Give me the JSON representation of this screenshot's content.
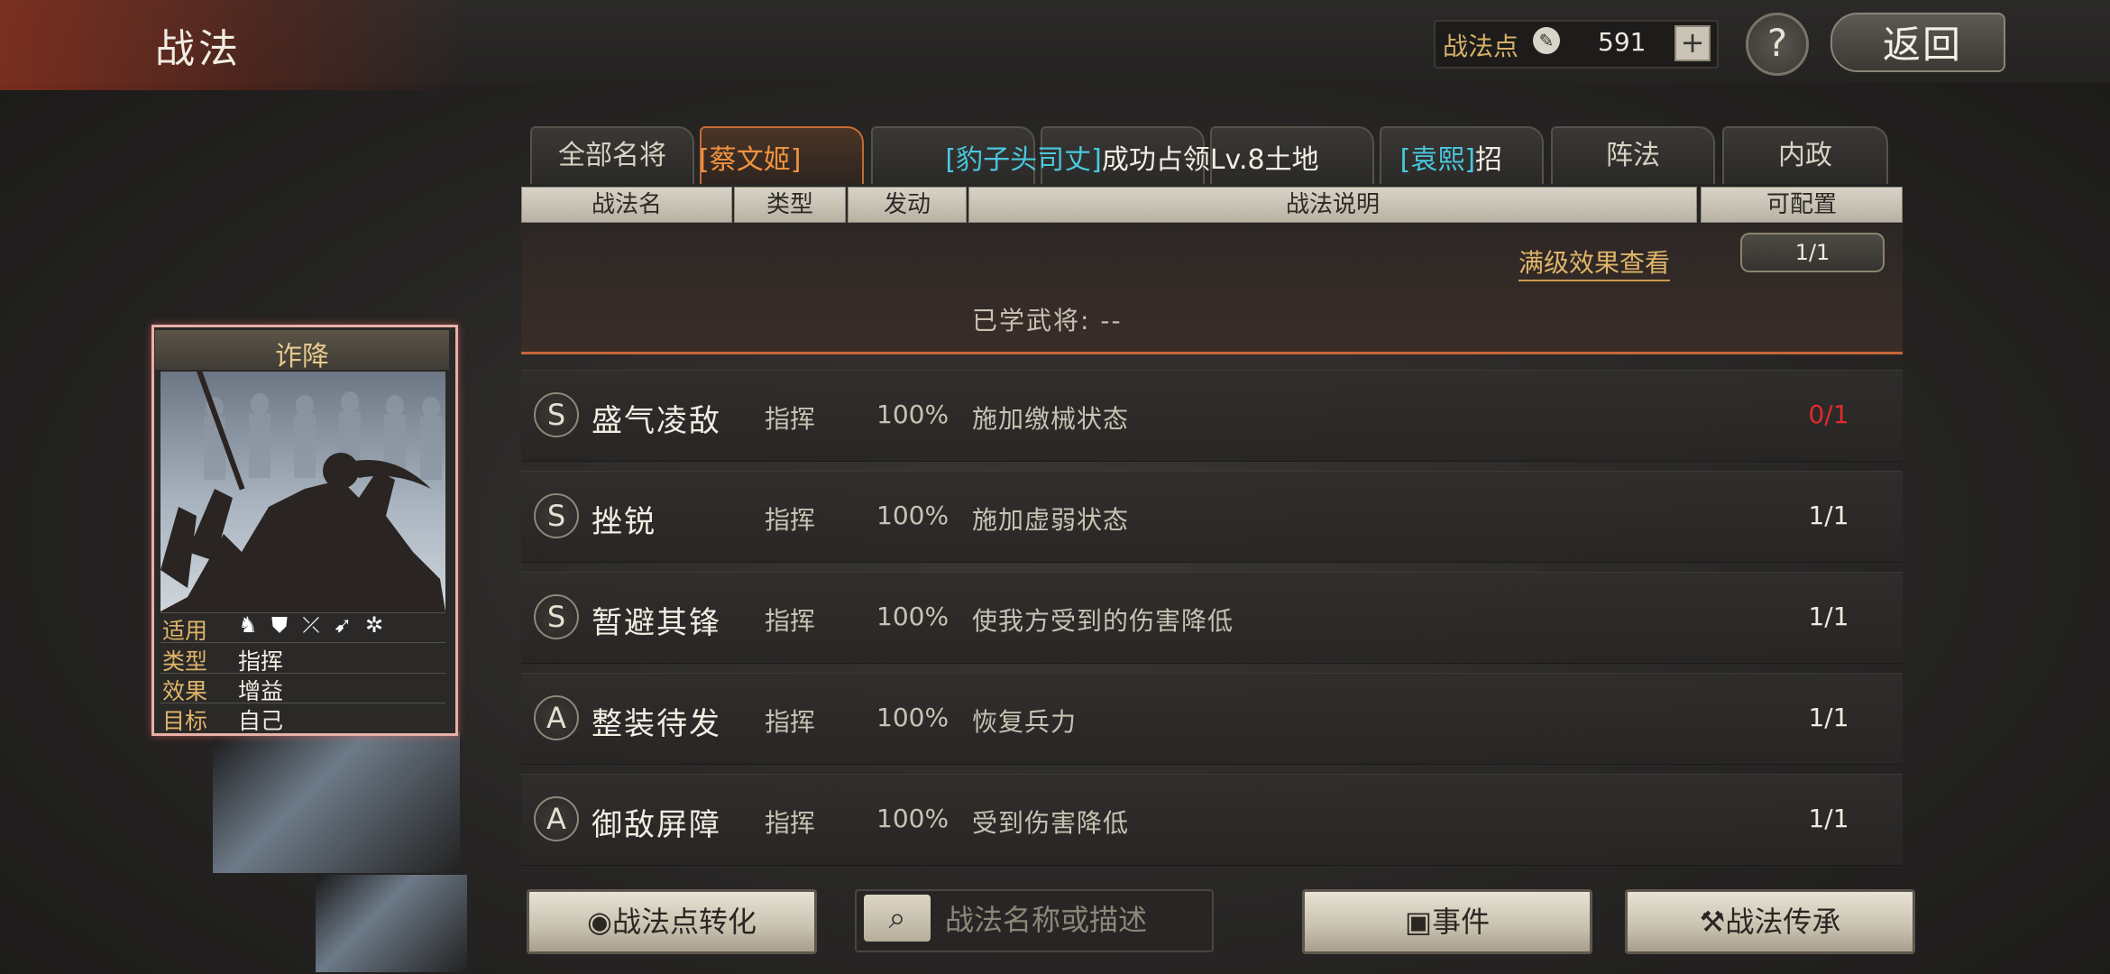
{
  "header": {
    "title": "战法",
    "points_label": "战法点",
    "points_value": "591",
    "add_label": "+",
    "help_label": "?",
    "back_label": "返回"
  },
  "tabs": [
    {
      "label": "全部名将"
    },
    {
      "label": ""
    },
    {
      "label": ""
    },
    {
      "label": ""
    },
    {
      "label": ""
    },
    {
      "label": ""
    },
    {
      "label": "阵法"
    },
    {
      "label": "内政"
    }
  ],
  "marquee": {
    "part1": "[蔡文姬]",
    "part2": "[豹子头司丈]",
    "part3": "成功占领Lv.8土地",
    "part4": "[袁熙]",
    "part5": "招"
  },
  "columns": {
    "name": "战法名",
    "type": "类型",
    "trigger": "发动",
    "description": "战法说明",
    "configurable": "可配置"
  },
  "detail": {
    "view_full_effect": "满级效果查看",
    "learned_generals": "已学武将:  --",
    "count": "1/1"
  },
  "tactics": [
    {
      "grade": "S",
      "name": "盛气凌敌",
      "type": "指挥",
      "rate": "100%",
      "description": "施加缴械状态",
      "count": "0/1",
      "count_color": "#e02a2a"
    },
    {
      "grade": "S",
      "name": "挫锐",
      "type": "指挥",
      "rate": "100%",
      "description": "施加虚弱状态",
      "count": "1/1",
      "count_color": "#efeadf"
    },
    {
      "grade": "S",
      "name": "暂避其锋",
      "type": "指挥",
      "rate": "100%",
      "description": "使我方受到的伤害降低",
      "count": "1/1",
      "count_color": "#efeadf"
    },
    {
      "grade": "A",
      "name": "整装待发",
      "type": "指挥",
      "rate": "100%",
      "description": "恢复兵力",
      "count": "1/1",
      "count_color": "#efeadf"
    },
    {
      "grade": "A",
      "name": "御敌屏障",
      "type": "指挥",
      "rate": "100%",
      "description": "受到伤害降低",
      "count": "1/1",
      "count_color": "#efeadf"
    }
  ],
  "card": {
    "title": "诈降",
    "applies_label": "适用",
    "type_label": "类型",
    "type_value": "指挥",
    "effect_label": "效果",
    "effect_value": "增益",
    "target_label": "目标",
    "target_value": "自己",
    "unit_icons": [
      "cavalry-icon",
      "shield-icon",
      "bow-icon",
      "spear-icon",
      "wheel-icon"
    ]
  },
  "bottom": {
    "convert_label": "战法点转化",
    "search_placeholder": "战法名称或描述",
    "events_label": "事件",
    "inherit_label": "战法传承"
  }
}
